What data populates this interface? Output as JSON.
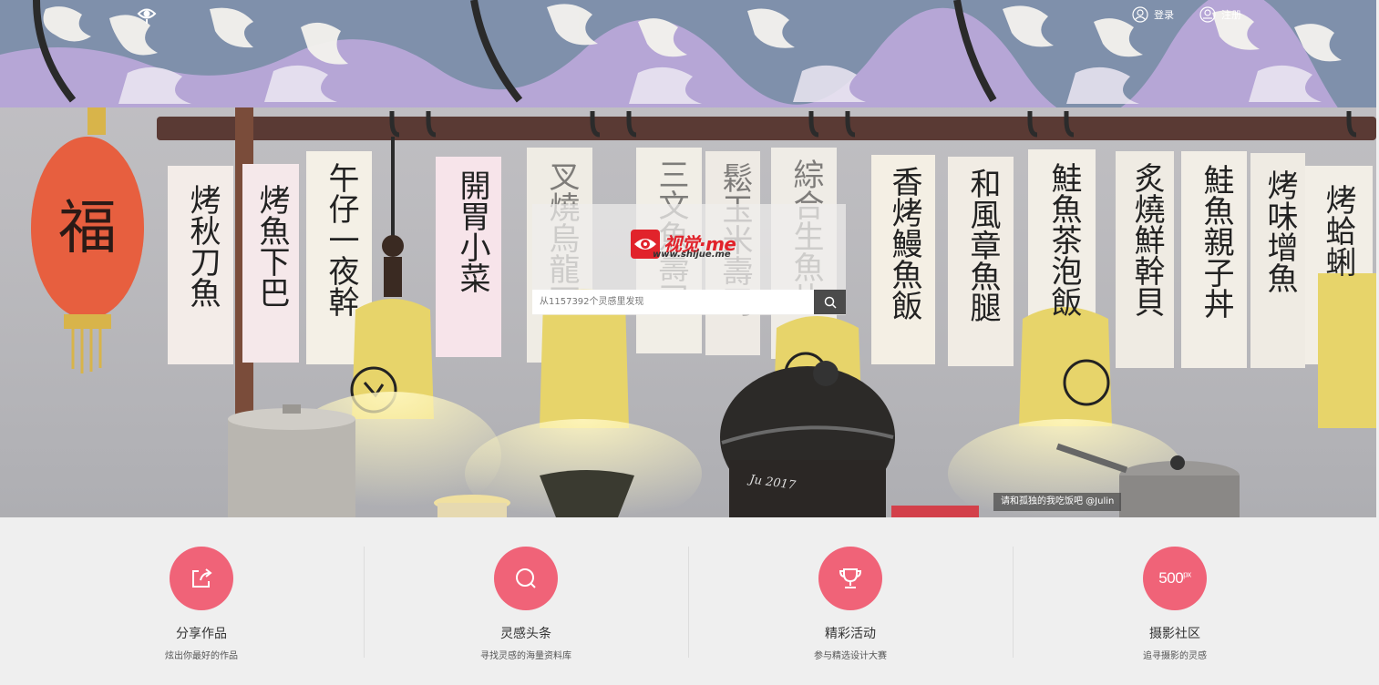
{
  "header": {
    "login_label": "登录",
    "register_label": "注册"
  },
  "hero": {
    "brand_name": "视觉·me",
    "brand_url": "www.shijue.me",
    "search_placeholder": "从1157392个灵感里发现",
    "credit": "请和孤独的我吃饭吧 @Julin",
    "lantern_char": "福",
    "signs": [
      "烤秋刀魚",
      "烤魚下巴",
      "午仔一夜幹",
      "開胃小菜",
      "叉燒烏龍面",
      "三文魚壽司",
      "鬆玉米壽司",
      "綜合生魚片",
      "香烤鰻魚飯",
      "和風章魚腿",
      "鮭魚茶泡飯",
      "炙燒鮮幹貝",
      "鮭魚親子丼",
      "烤味增魚",
      "烤蛤蜊"
    ],
    "pot_text": "Ju 2017"
  },
  "features": [
    {
      "icon": "share-icon",
      "title": "分享作品",
      "subtitle": "炫出你最好的作品"
    },
    {
      "icon": "search-icon",
      "title": "灵感头条",
      "subtitle": "寻找灵感的海量资料库"
    },
    {
      "icon": "trophy-icon",
      "title": "精彩活动",
      "subtitle": "参与精选设计大赛"
    },
    {
      "icon": "500px-icon",
      "title": "摄影社区",
      "subtitle": "追寻摄影的灵感"
    }
  ],
  "colors": {
    "accent": "#f06378",
    "brand_red": "#e1232b",
    "search_button": "#4b4b4b",
    "footer_bg": "#efefef"
  }
}
